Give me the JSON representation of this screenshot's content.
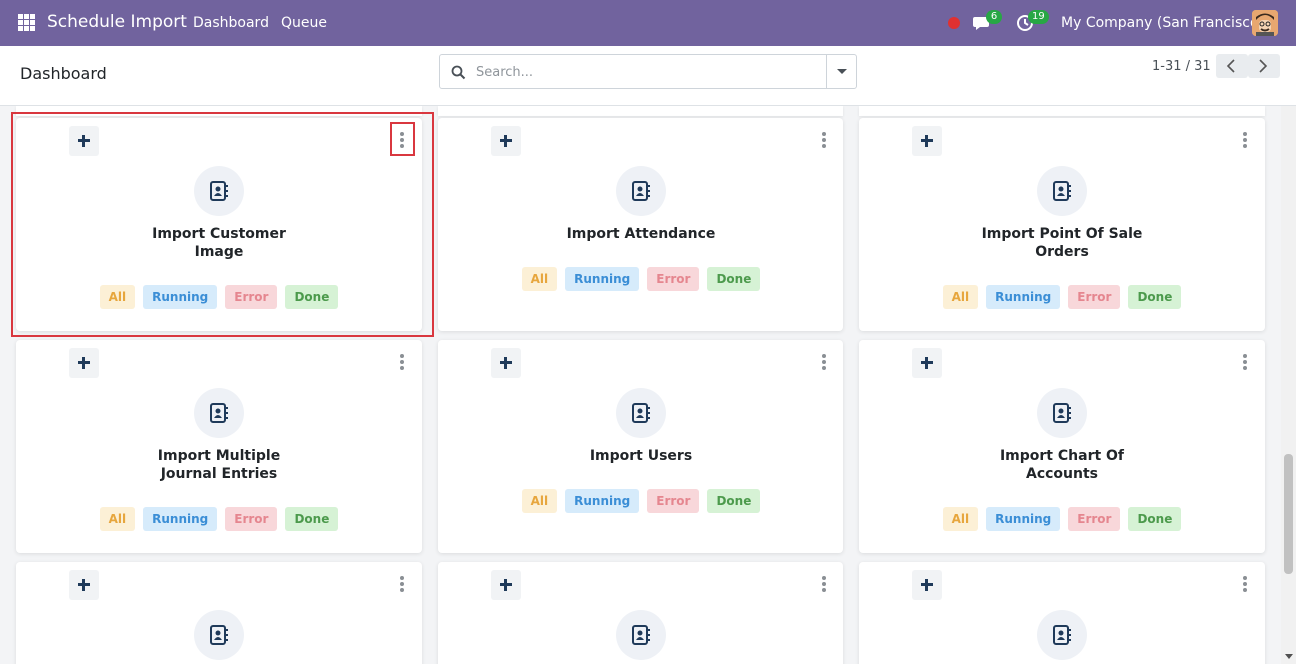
{
  "navbar": {
    "app_name": "Schedule Import",
    "menu": [
      {
        "label": "Dashboard"
      },
      {
        "label": "Queue"
      }
    ],
    "chat_count": "6",
    "activity_count": "19",
    "company": "My Company (San Francisco)"
  },
  "control_panel": {
    "title": "Dashboard",
    "search_placeholder": "Search...",
    "pager": "1-31 / 31"
  },
  "status_labels": {
    "all": "All",
    "running": "Running",
    "error": "Error",
    "done": "Done"
  },
  "cards": [
    {
      "title_line1": "Import Customer",
      "title_line2": "Image"
    },
    {
      "title_line1": "Import Attendance",
      "title_line2": ""
    },
    {
      "title_line1": "Import Point Of Sale",
      "title_line2": "Orders"
    },
    {
      "title_line1": "Import Multiple",
      "title_line2": "Journal Entries"
    },
    {
      "title_line1": "Import Users",
      "title_line2": ""
    },
    {
      "title_line1": "Import Chart Of",
      "title_line2": "Accounts"
    }
  ],
  "colors": {
    "navbar": "#71639e",
    "highlight": "#d9373f",
    "badge": "#28a745"
  }
}
